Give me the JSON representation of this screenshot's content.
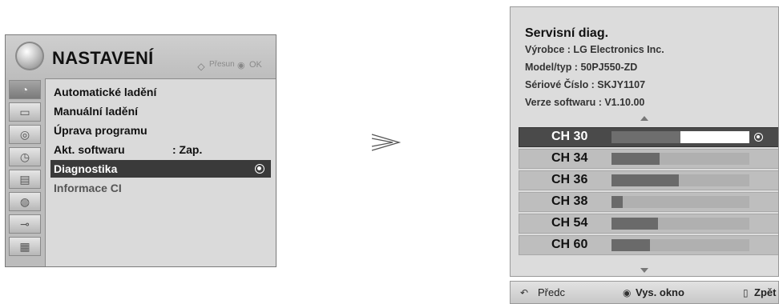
{
  "menu": {
    "title": "NASTAVENÍ",
    "hint_move_label": "Přesun",
    "hint_ok_label": "OK",
    "items": [
      {
        "label": "Automatické ladění",
        "value": ""
      },
      {
        "label": "Manuální ladění",
        "value": ""
      },
      {
        "label": "Úprava programu",
        "value": ""
      },
      {
        "label": "Akt. softwaru",
        "value": ": Zap."
      },
      {
        "label": "Diagnostika",
        "value": "",
        "selected": true
      },
      {
        "label": "Informace CI",
        "value": "",
        "dim": true
      }
    ],
    "side_icons": [
      "satellite-dish-icon",
      "picture-icon",
      "speaker-icon",
      "clock-icon",
      "lock-icon",
      "globe-icon",
      "cable-icon",
      "movie-icon"
    ]
  },
  "diag": {
    "title": "Servisní diag.",
    "manufacturer": "Výrobce : LG Electronics Inc.",
    "model": "Model/typ : 50PJ550-ZD",
    "serial": "Sériové Číslo : SKJY1107",
    "software": "Verze softwaru : V1.10.00",
    "channels": [
      {
        "label": "CH 30",
        "level": 0.5,
        "selected": true
      },
      {
        "label": "CH 34",
        "level": 0.35
      },
      {
        "label": "CH 36",
        "level": 0.49
      },
      {
        "label": "CH 38",
        "level": 0.08
      },
      {
        "label": "CH 54",
        "level": 0.34
      },
      {
        "label": "CH 60",
        "level": 0.28
      }
    ]
  },
  "footer": {
    "prev_label": "Předc",
    "window_label": "Vys. okno",
    "back_label": "Zpět"
  }
}
